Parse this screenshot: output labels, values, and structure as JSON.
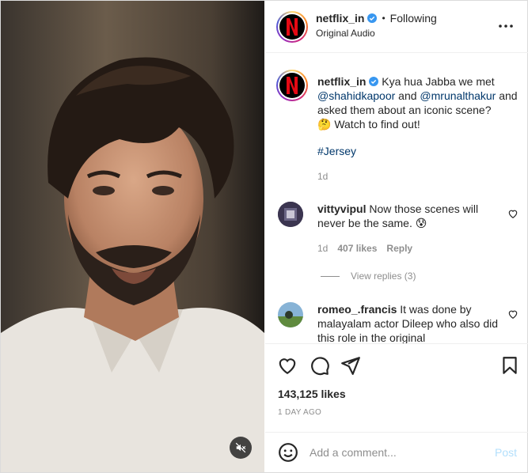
{
  "header": {
    "username": "netflix_in",
    "separator": "•",
    "follow_status": "Following",
    "audio": "Original Audio",
    "logo_letter": "N"
  },
  "caption": {
    "username": "netflix_in",
    "text_1": "Kya hua Jabba we met ",
    "mention_1": "@shahidkapoor",
    "text_2": " and ",
    "mention_2": "@mrunalthakur",
    "text_3": " and asked them about an iconic scene?",
    "text_4": "🤔 Watch to find out!",
    "hashtag": "#Jersey",
    "time": "1d"
  },
  "comments": [
    {
      "username": "vittyvipul",
      "text": "Now those scenes will never be the same. 😰",
      "time": "1d",
      "likes": "407 likes",
      "reply": "Reply",
      "view_replies": "View replies (3)"
    },
    {
      "username": "romeo_.francis",
      "text": "It was done by malayalam actor Dileep who also did this role in the original"
    }
  ],
  "actions": {
    "likes": "143,125 likes",
    "posted": "1 DAY AGO"
  },
  "add_comment": {
    "placeholder": "Add a comment...",
    "post_label": "Post"
  },
  "icons": [
    "mute-icon",
    "more-icon",
    "verified-icon",
    "heart-icon",
    "comment-icon",
    "share-icon",
    "bookmark-icon",
    "emoji-icon"
  ],
  "colors": {
    "verified": "#3897f0",
    "link": "#00376b",
    "post_disabled": "#b2dffc",
    "netflix_red": "#e50914"
  }
}
